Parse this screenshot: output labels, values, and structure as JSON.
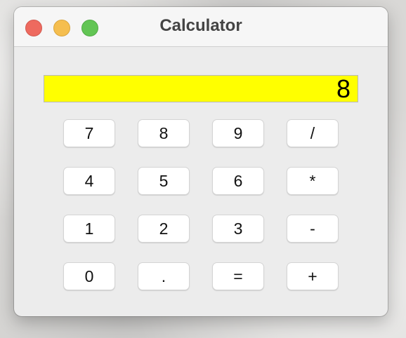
{
  "window": {
    "title": "Calculator",
    "controls": {
      "close_color": "#ee6a5f",
      "minimize_color": "#f5be4f",
      "maximize_color": "#62c554"
    }
  },
  "display": {
    "value": "8",
    "background": "#ffff00"
  },
  "keypad": {
    "rows": [
      [
        "7",
        "8",
        "9",
        "/"
      ],
      [
        "4",
        "5",
        "6",
        "*"
      ],
      [
        "1",
        "2",
        "3",
        "-"
      ],
      [
        "0",
        ".",
        "=",
        "+"
      ]
    ]
  }
}
